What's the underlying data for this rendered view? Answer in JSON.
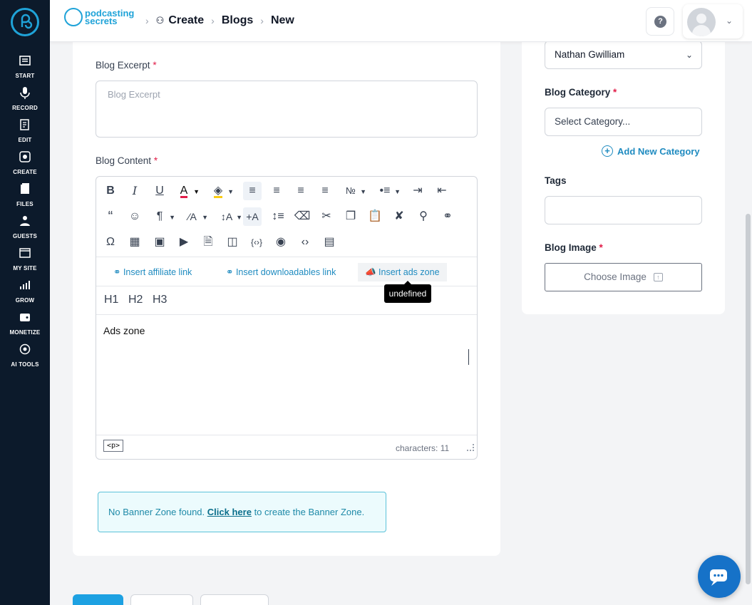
{
  "sidebar": {
    "items": [
      {
        "label": "START",
        "icon": "start-icon"
      },
      {
        "label": "RECORD",
        "icon": "microphone-icon"
      },
      {
        "label": "EDIT",
        "icon": "edit-icon"
      },
      {
        "label": "CREATE",
        "icon": "create-icon"
      },
      {
        "label": "FILES",
        "icon": "files-icon"
      },
      {
        "label": "GUESTS",
        "icon": "guests-icon"
      },
      {
        "label": "MY SITE",
        "icon": "website-icon"
      },
      {
        "label": "GROW",
        "icon": "chart-icon"
      },
      {
        "label": "MONETIZE",
        "icon": "monetize-icon"
      },
      {
        "label": "AI TOOLS",
        "icon": "ai-tools-icon"
      }
    ]
  },
  "header": {
    "brand_line1": "podcasting",
    "brand_line2": "secrets",
    "breadcrumbs": [
      "Create",
      "Blogs",
      "New"
    ],
    "help_label": "?"
  },
  "form": {
    "excerpt_label": "Blog Excerpt",
    "excerpt_placeholder": "Blog Excerpt",
    "content_label": "Blog Content",
    "required_mark": "*",
    "insert_links": [
      "Insert affiliate link",
      "Insert downloadables link",
      "Insert ads zone"
    ],
    "tooltip": "undefined",
    "headings": [
      "H1",
      "H2",
      "H3"
    ],
    "content_text": "Ads zone",
    "status_tag": "<p>",
    "char_count": "characters: 11",
    "alert_prefix": "No Banner Zone found.",
    "alert_link": "Click here",
    "alert_suffix": "to create the Banner Zone."
  },
  "side": {
    "author_value": "Nathan Gwilliam",
    "category_label": "Blog Category",
    "category_placeholder": "Select Category...",
    "add_category": "Add New Category",
    "tags_label": "Tags",
    "image_label": "Blog Image",
    "choose_image": "Choose Image"
  },
  "colors": {
    "sidebar_bg": "#0c1a2b",
    "accent": "#1fa3d8",
    "link": "#1f8bc0",
    "required": "#e11d48",
    "chat": "#1672c8"
  }
}
